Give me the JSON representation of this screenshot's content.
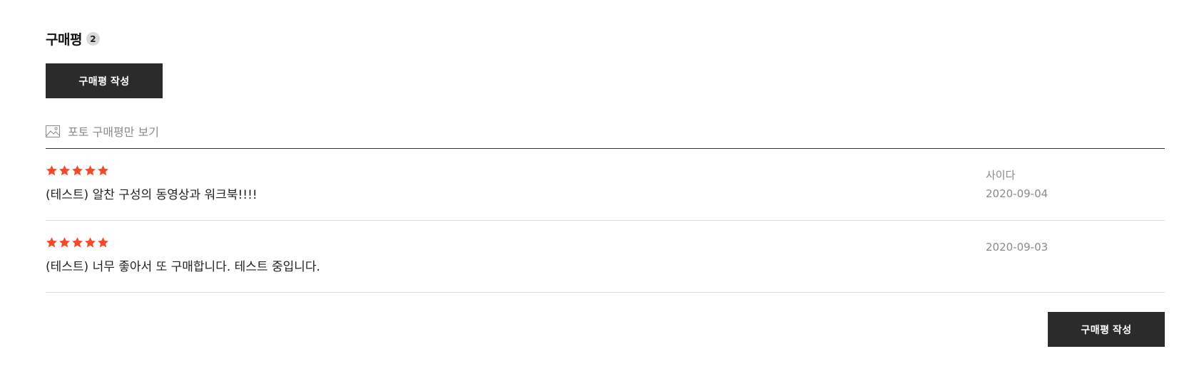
{
  "section": {
    "title": "구매평",
    "count": "2"
  },
  "buttons": {
    "write_top": "구매평 작성",
    "write_bottom": "구매평 작성"
  },
  "filter": {
    "photo_only_label": "포토 구매평만 보기"
  },
  "colors": {
    "star": "#f34a2c",
    "button_bg": "#2b2b2b"
  },
  "reviews": [
    {
      "rating": 5,
      "text": "(테스트) 알찬 구성의 동영상과 워크북!!!!",
      "author": "사이다",
      "date": "2020-09-04"
    },
    {
      "rating": 5,
      "text": "(테스트) 너무 좋아서 또 구매합니다. 테스트 중입니다.",
      "author": "",
      "date": "2020-09-03"
    }
  ]
}
